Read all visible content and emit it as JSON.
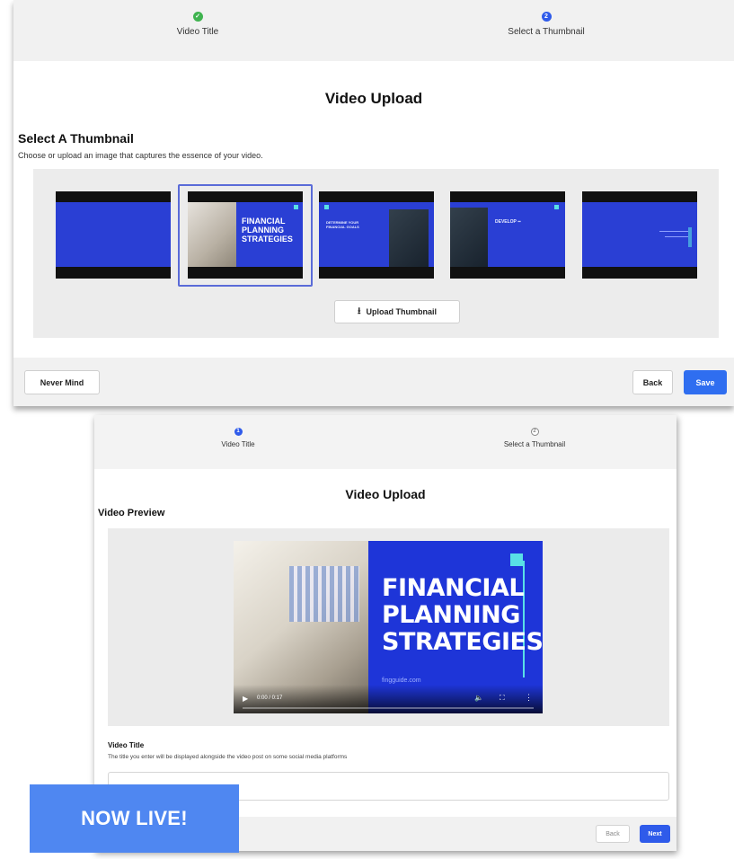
{
  "panel_top": {
    "steps": [
      {
        "label": "Video Title",
        "state": "complete",
        "marker": "✓"
      },
      {
        "label": "Select a Thumbnail",
        "state": "current",
        "marker": "2"
      }
    ],
    "title": "Video Upload",
    "section_title": "Select A Thumbnail",
    "section_description": "Choose or upload an image that captures the essence of your video.",
    "thumbnails": [
      {
        "name": "plain-blue-frame",
        "selected": false
      },
      {
        "name": "financial-planning-strategies",
        "selected": true,
        "text": "FINANCIAL PLANNING STRATEGIES"
      },
      {
        "name": "determine-financial-goals",
        "selected": false,
        "text": "DETERMINE YOUR FINANCIAL GOALS"
      },
      {
        "name": "develop-plan",
        "selected": false,
        "text": "DEVELOP"
      },
      {
        "name": "blue-frame-end",
        "selected": false
      }
    ],
    "upload_button": "Upload Thumbnail",
    "upload_icon": "upload-icon",
    "never_mind_button": "Never Mind",
    "back_button": "Back",
    "save_button": "Save"
  },
  "panel_bottom": {
    "steps": [
      {
        "label": "Video Title",
        "state": "current",
        "marker": "1"
      },
      {
        "label": "Select a Thumbnail",
        "state": "pending",
        "marker": "2"
      }
    ],
    "title": "Video Upload",
    "section_title": "Video Preview",
    "video": {
      "headline_line1": "FINANCIAL",
      "headline_line2": "PLANNING",
      "headline_line3": "STRATEGIES",
      "site": "fingguide.com",
      "time": "0:00 / 0:17",
      "progress": 0.0
    },
    "field_label": "Video Title",
    "field_help": "The title you enter will be displayed alongside the video post on some social media platforms",
    "back_button": "Back",
    "next_button": "Next"
  },
  "badge": "NOW LIVE!",
  "colors": {
    "primary_blue": "#2f6ef0",
    "step_complete_green": "#3fb34f",
    "thumbnail_blue": "#2a3fd4",
    "badge_blue": "#4f87f1",
    "accent_cyan": "#59e0e6"
  }
}
